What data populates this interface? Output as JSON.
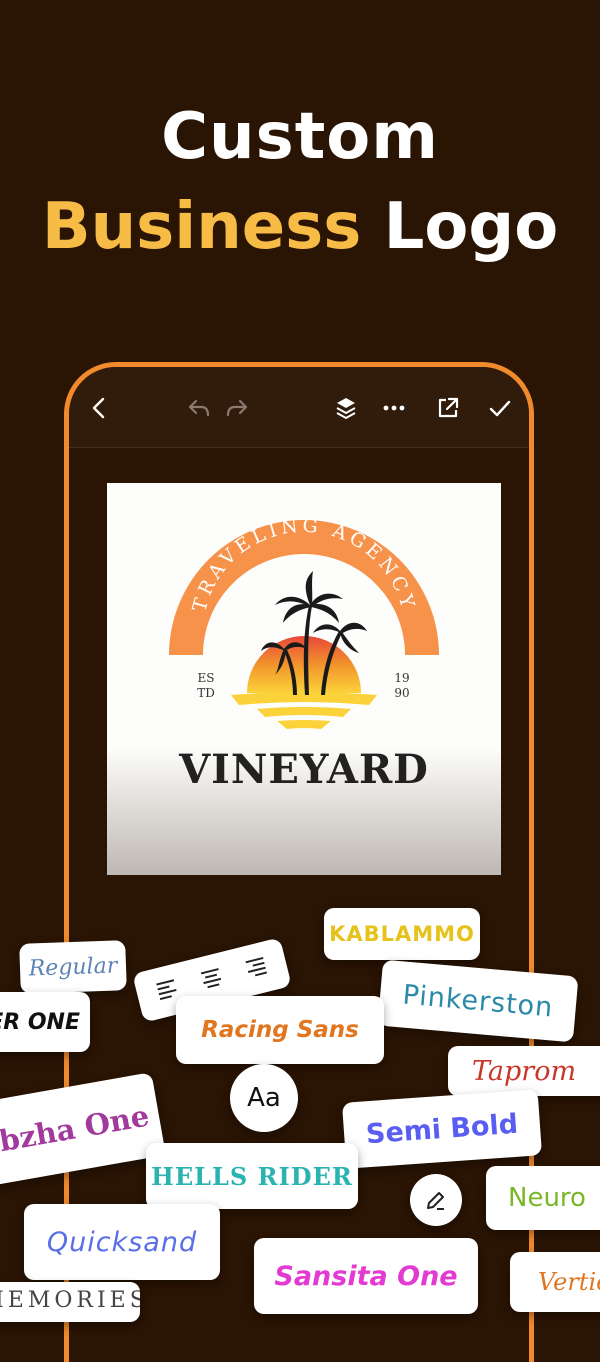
{
  "headline": {
    "line1": "Custom",
    "line2_accent": "Business",
    "line2_rest": " Logo",
    "accent_color": "#f7bc45"
  },
  "toolbar": {
    "icons": [
      "back-icon",
      "undo-icon",
      "redo-icon",
      "layers-icon",
      "more-icon",
      "export-icon",
      "check-icon"
    ]
  },
  "logo": {
    "arc_text": "TRAVELING AGENCY",
    "est_top": "ES",
    "est_bottom": "TD",
    "year_top": "19",
    "year_bottom": "90",
    "brand": "VINEYARD",
    "arc_color": "#f7924a"
  },
  "fonts": {
    "regular": "Regular",
    "kablammo": "KABLAMMO",
    "pinkerston": "Pinkerston",
    "racer_one": "RACER ONE",
    "racing_sans": "Racing Sans",
    "taprom": "Taprom",
    "aa": "Aa",
    "lobzha": "Lobzha One",
    "semi_bold": "Semi Bold",
    "hells_rider": "HELLS RIDER",
    "neuro": "Neuro",
    "quicksand": "Quicksand",
    "sansita": "Sansita One",
    "vertical": "Vertical",
    "memories": "MEMORIES"
  }
}
